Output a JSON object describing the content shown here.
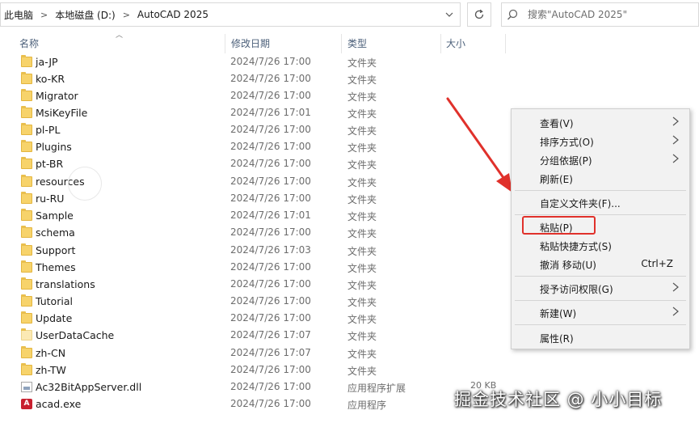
{
  "address_bar": {
    "crumbs": [
      "此电脑",
      "本地磁盘 (D:)",
      "AutoCAD 2025"
    ]
  },
  "search": {
    "placeholder": "搜索\"AutoCAD 2025\""
  },
  "columns": {
    "name": "名称",
    "date": "修改日期",
    "type": "类型",
    "size": "大小"
  },
  "files": [
    {
      "name": "ja-JP",
      "date": "2024/7/26 17:00",
      "type": "文件夹",
      "icon": "folder-icon"
    },
    {
      "name": "ko-KR",
      "date": "2024/7/26 17:00",
      "type": "文件夹",
      "icon": "folder-icon"
    },
    {
      "name": "Migrator",
      "date": "2024/7/26 17:00",
      "type": "文件夹",
      "icon": "folder-icon"
    },
    {
      "name": "MsiKeyFile",
      "date": "2024/7/26 17:01",
      "type": "文件夹",
      "icon": "folder-icon"
    },
    {
      "name": "pl-PL",
      "date": "2024/7/26 17:00",
      "type": "文件夹",
      "icon": "folder-icon"
    },
    {
      "name": "Plugins",
      "date": "2024/7/26 17:00",
      "type": "文件夹",
      "icon": "folder-icon"
    },
    {
      "name": "pt-BR",
      "date": "2024/7/26 17:00",
      "type": "文件夹",
      "icon": "folder-icon"
    },
    {
      "name": "resources",
      "date": "2024/7/26 17:00",
      "type": "文件夹",
      "icon": "folder-icon"
    },
    {
      "name": "ru-RU",
      "date": "2024/7/26 17:00",
      "type": "文件夹",
      "icon": "folder-icon"
    },
    {
      "name": "Sample",
      "date": "2024/7/26 17:01",
      "type": "文件夹",
      "icon": "folder-icon"
    },
    {
      "name": "schema",
      "date": "2024/7/26 17:00",
      "type": "文件夹",
      "icon": "folder-icon"
    },
    {
      "name": "Support",
      "date": "2024/7/26 17:03",
      "type": "文件夹",
      "icon": "folder-icon"
    },
    {
      "name": "Themes",
      "date": "2024/7/26 17:00",
      "type": "文件夹",
      "icon": "folder-icon"
    },
    {
      "name": "translations",
      "date": "2024/7/26 17:00",
      "type": "文件夹",
      "icon": "folder-icon"
    },
    {
      "name": "Tutorial",
      "date": "2024/7/26 17:00",
      "type": "文件夹",
      "icon": "folder-icon"
    },
    {
      "name": "Update",
      "date": "2024/7/26 17:00",
      "type": "文件夹",
      "icon": "folder-icon"
    },
    {
      "name": "UserDataCache",
      "date": "2024/7/26 17:07",
      "type": "文件夹",
      "icon": "folder-light-icon"
    },
    {
      "name": "zh-CN",
      "date": "2024/7/26 17:07",
      "type": "文件夹",
      "icon": "folder-icon"
    },
    {
      "name": "zh-TW",
      "date": "2024/7/26 17:00",
      "type": "文件夹",
      "icon": "folder-icon"
    },
    {
      "name": "Ac32BitAppServer.dll",
      "date": "2024/7/26 17:00",
      "type": "应用程序扩展",
      "size": "20 KB",
      "icon": "dll-file-icon"
    },
    {
      "name": "acad.exe",
      "date": "2024/7/26 17:00",
      "type": "应用程序",
      "icon": "autocad-exe-icon"
    }
  ],
  "context_menu": {
    "items": [
      {
        "label": "查看(V)",
        "submenu": true
      },
      {
        "label": "排序方式(O)",
        "submenu": true
      },
      {
        "label": "分组依据(P)",
        "submenu": true
      },
      {
        "label": "刷新(E)"
      },
      {
        "separator": true
      },
      {
        "label": "自定义文件夹(F)..."
      },
      {
        "separator": true
      },
      {
        "label": "粘贴(P)",
        "highlighted": true
      },
      {
        "label": "粘贴快捷方式(S)"
      },
      {
        "label": "撤消 移动(U)",
        "shortcut": "Ctrl+Z"
      },
      {
        "separator": true
      },
      {
        "label": "授予访问权限(G)",
        "submenu": true
      },
      {
        "separator": true
      },
      {
        "label": "新建(W)",
        "submenu": true
      },
      {
        "separator": true
      },
      {
        "label": "属性(R)"
      }
    ]
  },
  "annotation": {
    "arrow_color": "#e0312b",
    "highlight_color": "#e0312b"
  },
  "watermark": "掘金技术社区 @ 小小目标"
}
